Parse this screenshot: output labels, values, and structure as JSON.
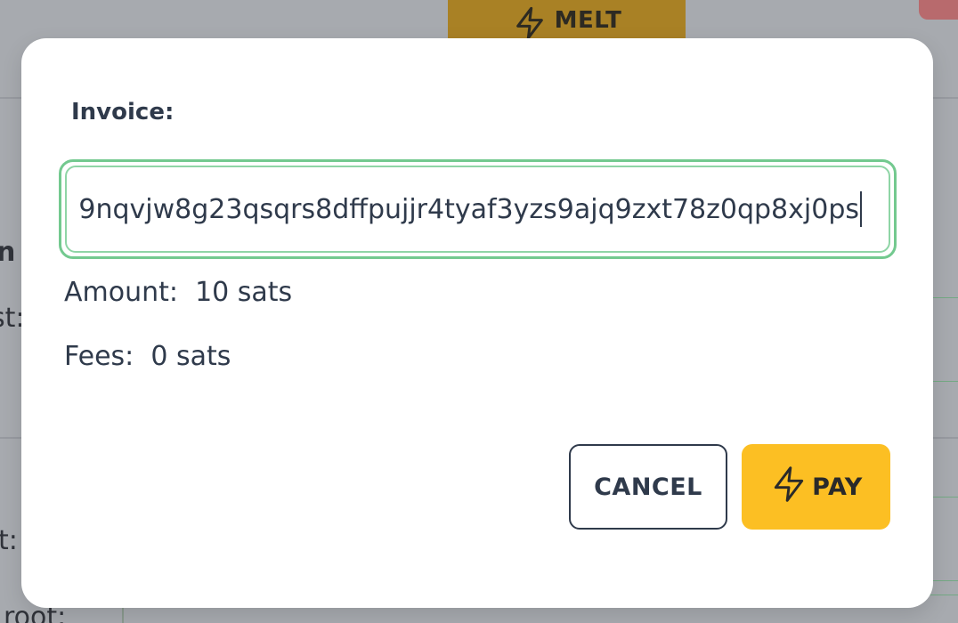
{
  "background": {
    "melt_label": "MELT",
    "fragments": {
      "left_top": "n",
      "left_second": "st:",
      "left_third": "t:",
      "left_bottom": "root:"
    }
  },
  "dialog": {
    "invoice_label": "Invoice:",
    "invoice_value": "9nqvjw8g23qsqrs8dffpujjr4tyaf3yzs9ajq9zxt78z0qp8xj0ps",
    "amount_text": "Amount:  10 sats",
    "fees_text": "Fees:  0 sats",
    "cancel_label": "CANCEL",
    "pay_label": "PAY"
  },
  "icons": {
    "melt": "lightning-bolt-icon",
    "pay": "lightning-bolt-icon"
  },
  "colors": {
    "accent_yellow": "#fcbf23",
    "input_focus_green": "#73c98f",
    "text_dark": "#2f3a4b",
    "overlay_gray": "#a7aaaf"
  }
}
